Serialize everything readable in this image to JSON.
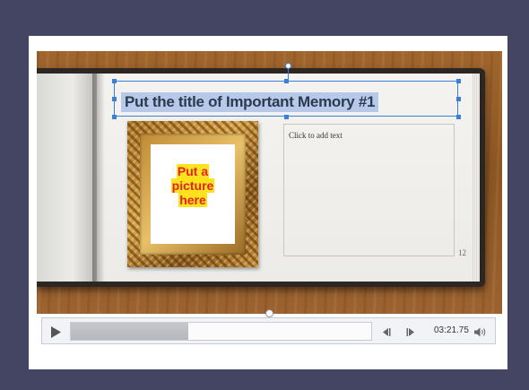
{
  "slide": {
    "title": "Put the title of Important Memory #1",
    "picture_placeholder_lines": [
      "Put a",
      "picture",
      "here"
    ],
    "text_placeholder": "Click to add text",
    "page_number": "12"
  },
  "player": {
    "play_icon": "play-icon",
    "progress_fraction": 0.39,
    "time": "03:21.75",
    "prev_icon": "previous-frame-icon",
    "next_icon": "next-frame-icon",
    "volume_icon": "volume-icon"
  },
  "colors": {
    "page_background": "#444463",
    "selection_blue": "#3a7fd9",
    "title_highlight": "#b7c9ea",
    "placeholder_red": "#e3241e",
    "placeholder_yellow": "#ffe21e"
  }
}
